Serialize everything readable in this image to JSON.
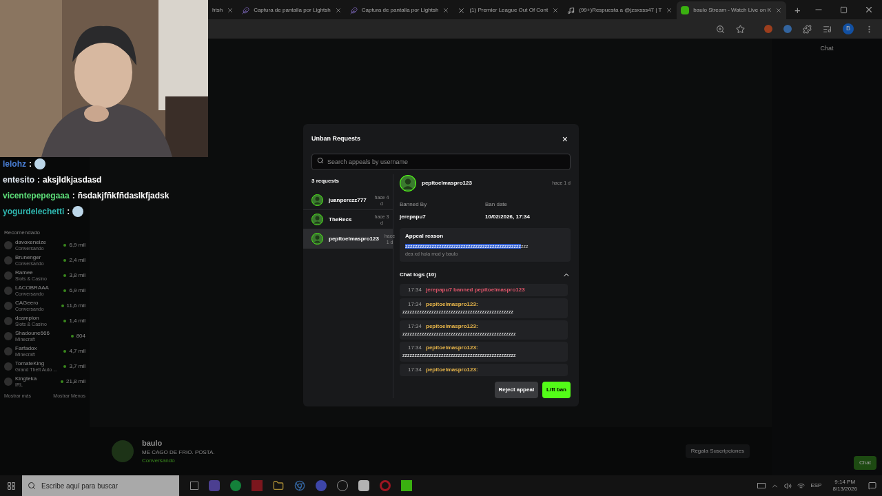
{
  "browser": {
    "tabs": [
      {
        "title": "htsh",
        "selected": false,
        "kind": "plain"
      },
      {
        "title": "Captura de pantalla por Lightsh",
        "selected": false,
        "kind": "feather"
      },
      {
        "title": "Captura de pantalla por Lightsh",
        "selected": false,
        "kind": "feather"
      },
      {
        "title": "(1) Premier League Out Of Cont",
        "selected": false,
        "kind": "x"
      },
      {
        "title": "(99+)Respuesta a @jzsxsss47 | T",
        "selected": false,
        "kind": "tiktok"
      },
      {
        "title": "baulo Stream - Watch Live on K",
        "selected": true,
        "kind": "kick"
      }
    ],
    "new_tab": "+",
    "profile": "B"
  },
  "overlay_chat": [
    {
      "user": "lelohz",
      "sep": ":",
      "color": "#4a7fd6",
      "kind": "emote"
    },
    {
      "user": "entesito",
      "sep": ":",
      "text": "aksjldkjasdasd",
      "color": "#dfe6ee",
      "kind": "text"
    },
    {
      "user": "vicentepepegaaa",
      "sep": ":",
      "text": "ñsdakjfñkfñdaslkfjadsk",
      "color": "#5ee07a",
      "kind": "text"
    },
    {
      "user": "yogurdelechetti",
      "sep": ":",
      "color": "#2fb7b0",
      "kind": "emote"
    }
  ],
  "recommended": {
    "title": "Recomendado",
    "items": [
      {
        "name": "davoxeneize",
        "category": "Conversando",
        "viewers": "6,9 mil"
      },
      {
        "name": "Brunenger",
        "category": "Conversando",
        "viewers": "2,4 mil"
      },
      {
        "name": "Ramee",
        "category": "Slots & Casino",
        "viewers": "3,8 mil"
      },
      {
        "name": "LACOBRAAA",
        "category": "Conversando",
        "viewers": "6,9 mil"
      },
      {
        "name": "CAGeero",
        "category": "Conversando",
        "viewers": "11,6 mil"
      },
      {
        "name": "dcampion",
        "category": "Slots & Casino",
        "viewers": "1,4 mil"
      },
      {
        "name": "Shadoune666",
        "category": "Minecraft",
        "viewers": "804"
      },
      {
        "name": "Farfadox",
        "category": "Minecraft",
        "viewers": "4,7 mil"
      },
      {
        "name": "TomateKing",
        "category": "Grand Theft Auto ...",
        "viewers": "3,7 mil"
      },
      {
        "name": "Kingteka",
        "category": "IRL",
        "viewers": "21,8 mil"
      }
    ],
    "show_more": "Mostrar más",
    "show_less": "Mostrar Menos"
  },
  "channel": {
    "name": "baulo",
    "title": "ME CAGO DE FRIO. POSTA.",
    "category": "Conversando",
    "gift": "Regala Suscripciones"
  },
  "side_chat": {
    "title": "Chat",
    "send": "Chat"
  },
  "modal": {
    "title": "Unban Requests",
    "close": "×",
    "search": {
      "placeholder": "Search appeals by username"
    },
    "count": "3 requests",
    "requests": [
      {
        "user": "juanperezz777",
        "time": "hace 4 d",
        "selected": false
      },
      {
        "user": "TheRecs",
        "time": "hace 3 d",
        "selected": false
      },
      {
        "user": "pepitoelmaspro123",
        "time": "hace 1 d",
        "selected": true
      }
    ],
    "detail": {
      "user": "pepitoelmaspro123",
      "time": "hace 1 d",
      "banned_by_label": "Banned By",
      "banned_by": "jerepapu7",
      "ban_date_label": "Ban date",
      "ban_date": "10/02/2026, 17:34",
      "reason_label": "Appeal reason",
      "reason_selected": "zzzzzzzzzzzzzzzzzzzzzzzzzzzzzzzzzzzzzzzzzzzzzzzz",
      "reason_rest": "zzz",
      "reason_line2": "dea xd hola mod y baulo"
    },
    "logs": {
      "title": "Chat logs (10)",
      "expanded": true,
      "entries": [
        {
          "time": "17:34",
          "kind": "ban",
          "text": "jerepapu7 banned pepitoelmaspro123"
        },
        {
          "time": "17:34",
          "kind": "message",
          "user": "pepitoelmaspro123:",
          "text": "zzzzzzzzzzzzzzzzzzzzzzzzzzzzzzzzzzzzzzzzzzzzzz"
        },
        {
          "time": "17:34",
          "kind": "message",
          "user": "pepitoelmaspro123:",
          "text": "zzzzzzzzzzzzzzzzzzzzzzzzzzzzzzzzzzzzzzzzzzzzzzz"
        },
        {
          "time": "17:34",
          "kind": "message",
          "user": "pepitoelmaspro123:",
          "text": "zzzzzzzzzzzzzzzzzzzzzzzzzzzzzzzzzzzzzzzzzzzzzzz"
        },
        {
          "time": "17:34",
          "kind": "message",
          "user": "pepitoelmaspro123:"
        }
      ]
    },
    "reject": "Reject appeal",
    "lift": "Lift ban"
  },
  "taskbar": {
    "search": "Escribe aquí para buscar",
    "lang": "ESP",
    "time": "9:14 PM",
    "date": "8/13/2026"
  }
}
